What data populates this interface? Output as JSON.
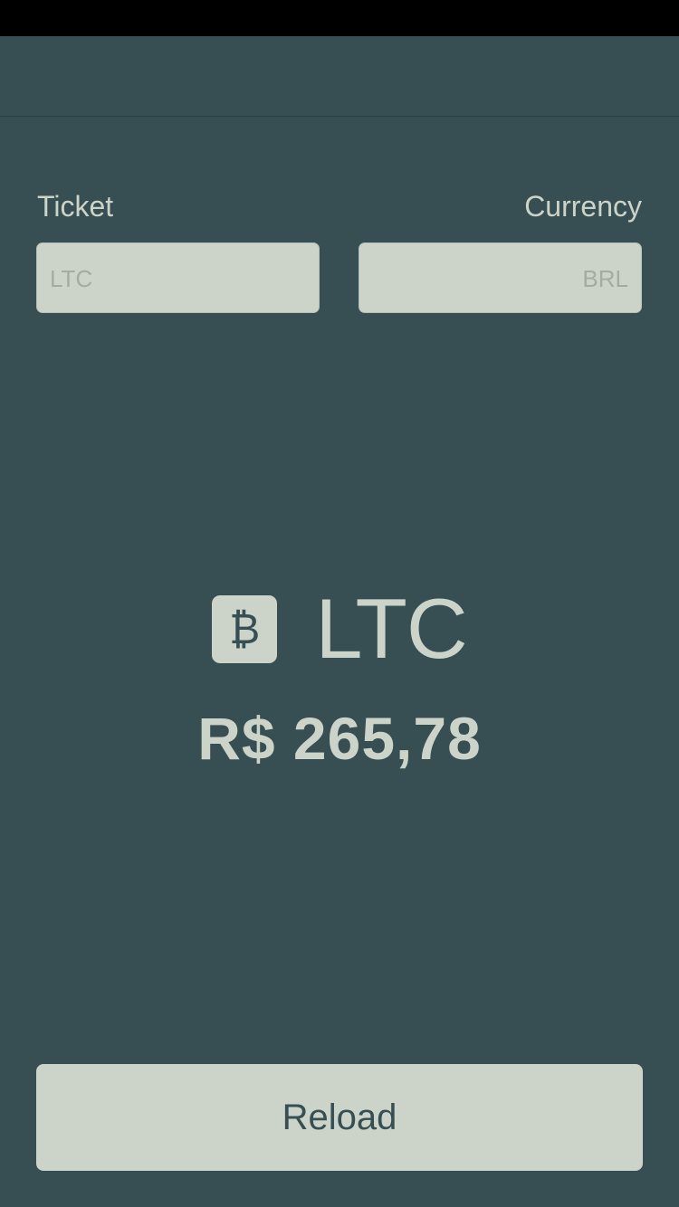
{
  "form": {
    "ticket_label": "Ticket",
    "currency_label": "Currency",
    "ticket_placeholder": "LTC",
    "currency_placeholder": "BRL"
  },
  "quote": {
    "icon": "bitcoin-icon",
    "icon_glyph": "₿",
    "symbol": "LTC",
    "price": "R$ 265,78"
  },
  "actions": {
    "reload_label": "Reload"
  },
  "colors": {
    "background": "#374f53",
    "accent": "#ccd4c9",
    "status_bar": "#000000"
  }
}
